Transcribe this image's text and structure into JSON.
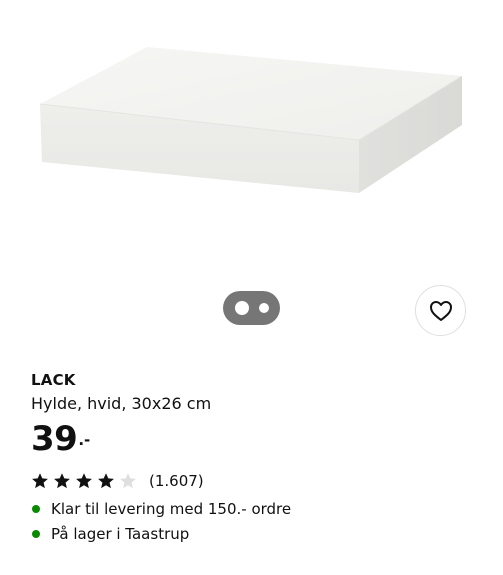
{
  "product": {
    "name": "LACK",
    "description": "Hylde, hvid, 30x26 cm",
    "price_integer": "39",
    "price_decimal": ".-",
    "rating": 4,
    "rating_max": 5,
    "rating_count": "(1.607)"
  },
  "gallery": {
    "active_index": 0,
    "total": 2
  },
  "favorite": {
    "icon": "heart-icon"
  },
  "availability": [
    {
      "text": "Klar til levering med 150.- ordre",
      "status_color": "#0a8a00"
    },
    {
      "text": "På lager i Taastrup",
      "status_color": "#0a8a00"
    }
  ],
  "colors": {
    "star_filled": "#111111",
    "star_empty": "#dfdfdf",
    "pager_bg": "#767676"
  }
}
